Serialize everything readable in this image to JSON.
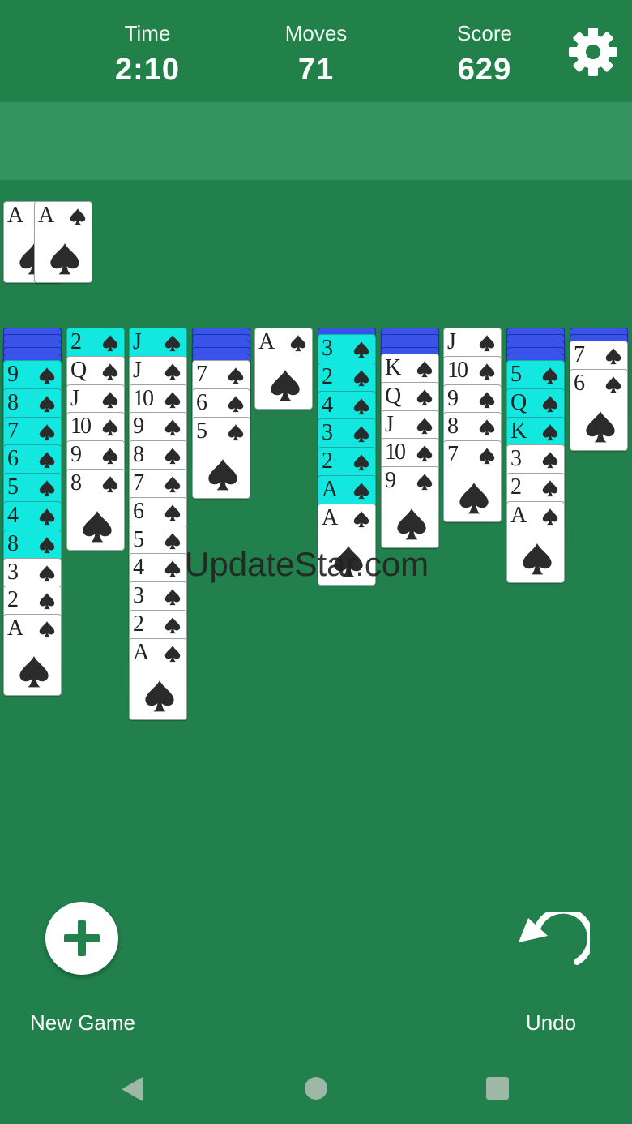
{
  "header": {
    "time_label": "Time",
    "time_value": "2:10",
    "moves_label": "Moves",
    "moves_value": "71",
    "score_label": "Score",
    "score_value": "629",
    "settings_icon": "gear-icon"
  },
  "foundation": [
    {
      "rank": "A",
      "suit": "spade"
    },
    {
      "rank": "A",
      "suit": "spade"
    }
  ],
  "tableau": [
    {
      "face_down": 5,
      "cards": [
        {
          "rank": "9",
          "hl": true
        },
        {
          "rank": "8",
          "hl": true
        },
        {
          "rank": "7",
          "hl": true
        },
        {
          "rank": "6",
          "hl": true
        },
        {
          "rank": "5",
          "hl": true
        },
        {
          "rank": "4",
          "hl": true
        },
        {
          "rank": "8",
          "hl": true
        },
        {
          "rank": "3",
          "hl": false
        },
        {
          "rank": "2",
          "hl": false
        },
        {
          "rank": "A",
          "hl": false
        }
      ]
    },
    {
      "face_down": 0,
      "cards": [
        {
          "rank": "2",
          "hl": true
        },
        {
          "rank": "Q",
          "hl": false
        },
        {
          "rank": "J",
          "hl": false
        },
        {
          "rank": "10",
          "hl": false
        },
        {
          "rank": "9",
          "hl": false
        },
        {
          "rank": "8",
          "hl": false
        }
      ]
    },
    {
      "face_down": 0,
      "cards": [
        {
          "rank": "J",
          "hl": true
        },
        {
          "rank": "J",
          "hl": false
        },
        {
          "rank": "10",
          "hl": false
        },
        {
          "rank": "9",
          "hl": false
        },
        {
          "rank": "8",
          "hl": false
        },
        {
          "rank": "7",
          "hl": false
        },
        {
          "rank": "6",
          "hl": false
        },
        {
          "rank": "5",
          "hl": false
        },
        {
          "rank": "4",
          "hl": false
        },
        {
          "rank": "3",
          "hl": false
        },
        {
          "rank": "2",
          "hl": false
        },
        {
          "rank": "A",
          "hl": false
        }
      ]
    },
    {
      "face_down": 5,
      "cards": [
        {
          "rank": "7",
          "hl": false
        },
        {
          "rank": "6",
          "hl": false
        },
        {
          "rank": "5",
          "hl": false
        }
      ]
    },
    {
      "face_down": 0,
      "cards": [
        {
          "rank": "A",
          "hl": false
        }
      ]
    },
    {
      "face_down": 1,
      "cards": [
        {
          "rank": "3",
          "hl": true
        },
        {
          "rank": "2",
          "hl": true
        },
        {
          "rank": "4",
          "hl": true
        },
        {
          "rank": "3",
          "hl": true
        },
        {
          "rank": "2",
          "hl": true
        },
        {
          "rank": "A",
          "hl": true
        },
        {
          "rank": "A",
          "hl": false
        }
      ]
    },
    {
      "face_down": 4,
      "cards": [
        {
          "rank": "K",
          "hl": false
        },
        {
          "rank": "Q",
          "hl": false
        },
        {
          "rank": "J",
          "hl": false
        },
        {
          "rank": "10",
          "hl": false
        },
        {
          "rank": "9",
          "hl": false
        }
      ]
    },
    {
      "face_down": 0,
      "cards": [
        {
          "rank": "J",
          "hl": false
        },
        {
          "rank": "10",
          "hl": false
        },
        {
          "rank": "9",
          "hl": false
        },
        {
          "rank": "8",
          "hl": false
        },
        {
          "rank": "7",
          "hl": false
        }
      ]
    },
    {
      "face_down": 5,
      "cards": [
        {
          "rank": "5",
          "hl": true
        },
        {
          "rank": "Q",
          "hl": true
        },
        {
          "rank": "K",
          "hl": true
        },
        {
          "rank": "3",
          "hl": false
        },
        {
          "rank": "2",
          "hl": false
        },
        {
          "rank": "A",
          "hl": false
        }
      ]
    },
    {
      "face_down": 2,
      "cards": [
        {
          "rank": "7",
          "hl": false
        },
        {
          "rank": "6",
          "hl": false
        }
      ]
    }
  ],
  "watermark": "UpdateStar.com",
  "controls": {
    "new_game_label": "New Game",
    "new_game_icon": "plus-icon",
    "undo_label": "Undo",
    "undo_icon": "undo-arrow-icon"
  },
  "navbar": {
    "back_icon": "back-triangle-icon",
    "home_icon": "home-circle-icon",
    "recents_icon": "recents-square-icon"
  },
  "colors": {
    "felt": "#22804c",
    "band": "#34935f",
    "highlight": "#12e8df",
    "card_back": "#2a48e0"
  }
}
